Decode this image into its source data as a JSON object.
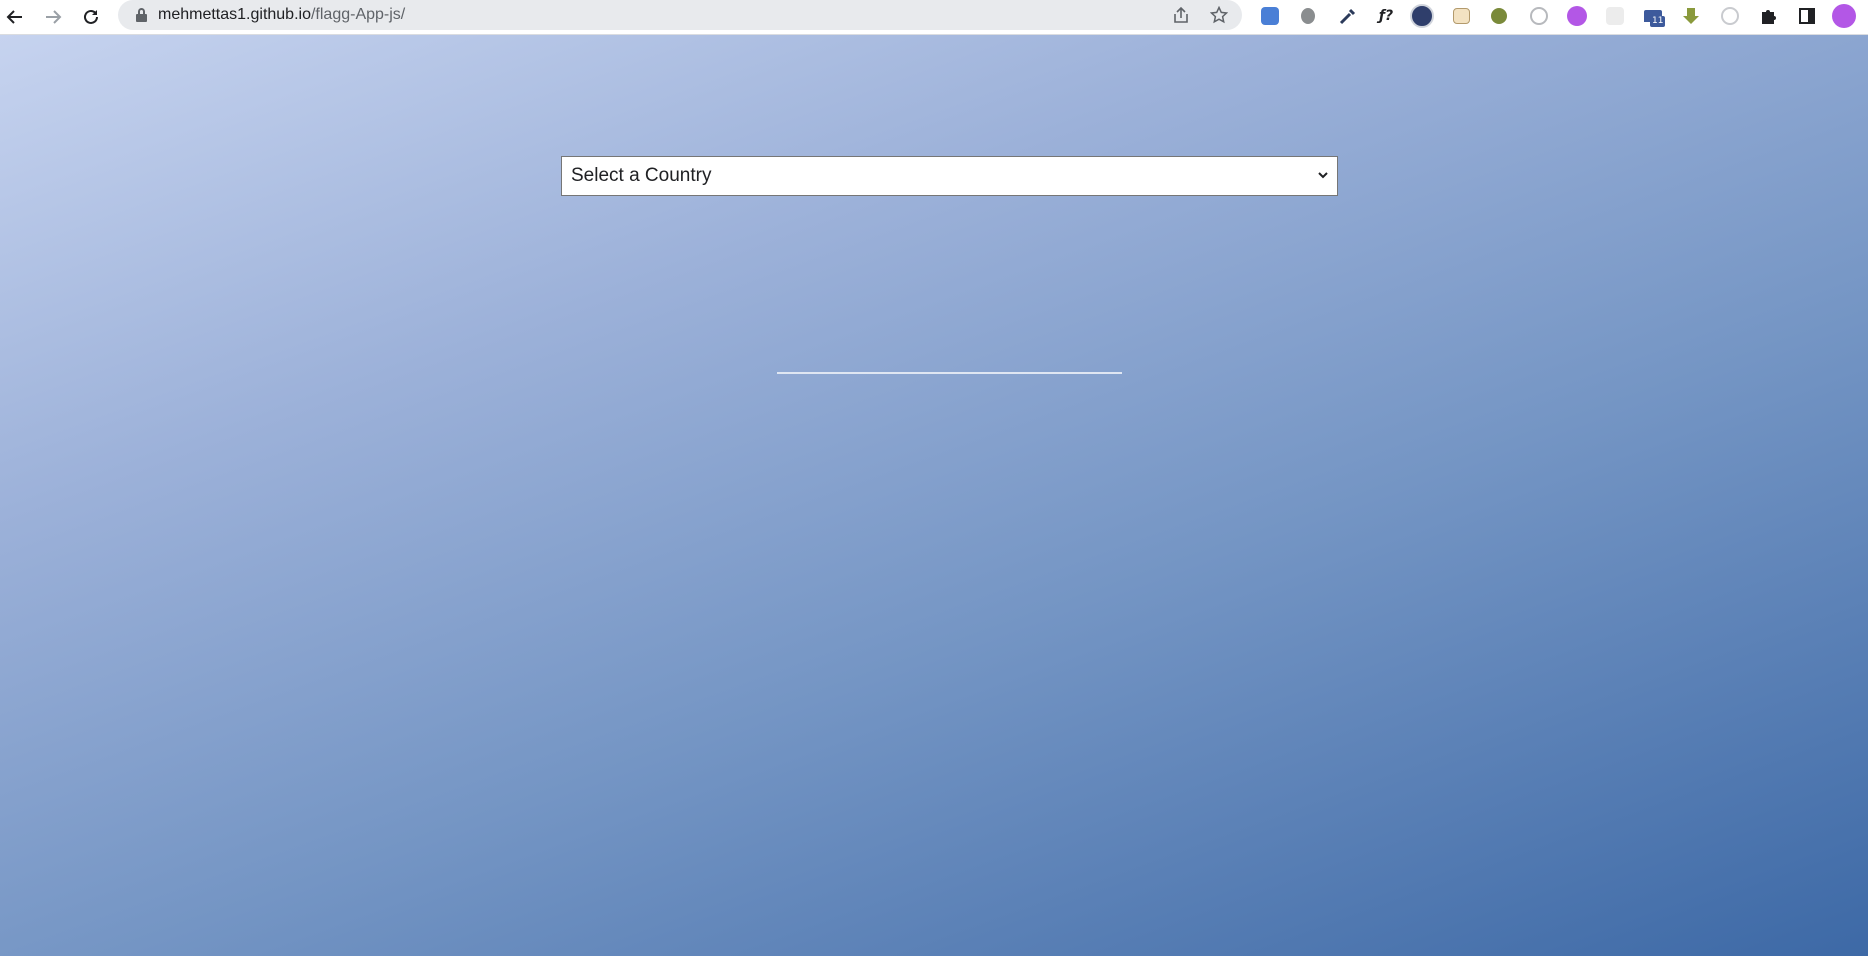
{
  "browser": {
    "back_icon": "arrow-left-icon",
    "forward_icon": "arrow-right-icon",
    "reload_icon": "reload-icon",
    "url_host": "mehmettas1.github.io",
    "url_path": "/flagg-App-js/",
    "share_icon": "share-icon",
    "bookmark_icon": "star-icon",
    "extensions": [
      "translate-extension-icon",
      "bug-extension-icon",
      "color-picker-extension-icon",
      "font-finder-extension-icon",
      "ninja-extension-icon",
      "tab-extension-icon",
      "html-tree-extension-icon",
      "compass-extension-icon",
      "purple-extension-icon",
      "blank-extension-icon",
      "house-badge-extension-icon",
      "download-arrow-extension-icon",
      "circle-extension-icon",
      "puzzle-icon",
      "side-panel-icon",
      "profile-avatar"
    ],
    "extension_badge": "11"
  },
  "main": {
    "select": {
      "selected_value": "Select a Country"
    }
  }
}
